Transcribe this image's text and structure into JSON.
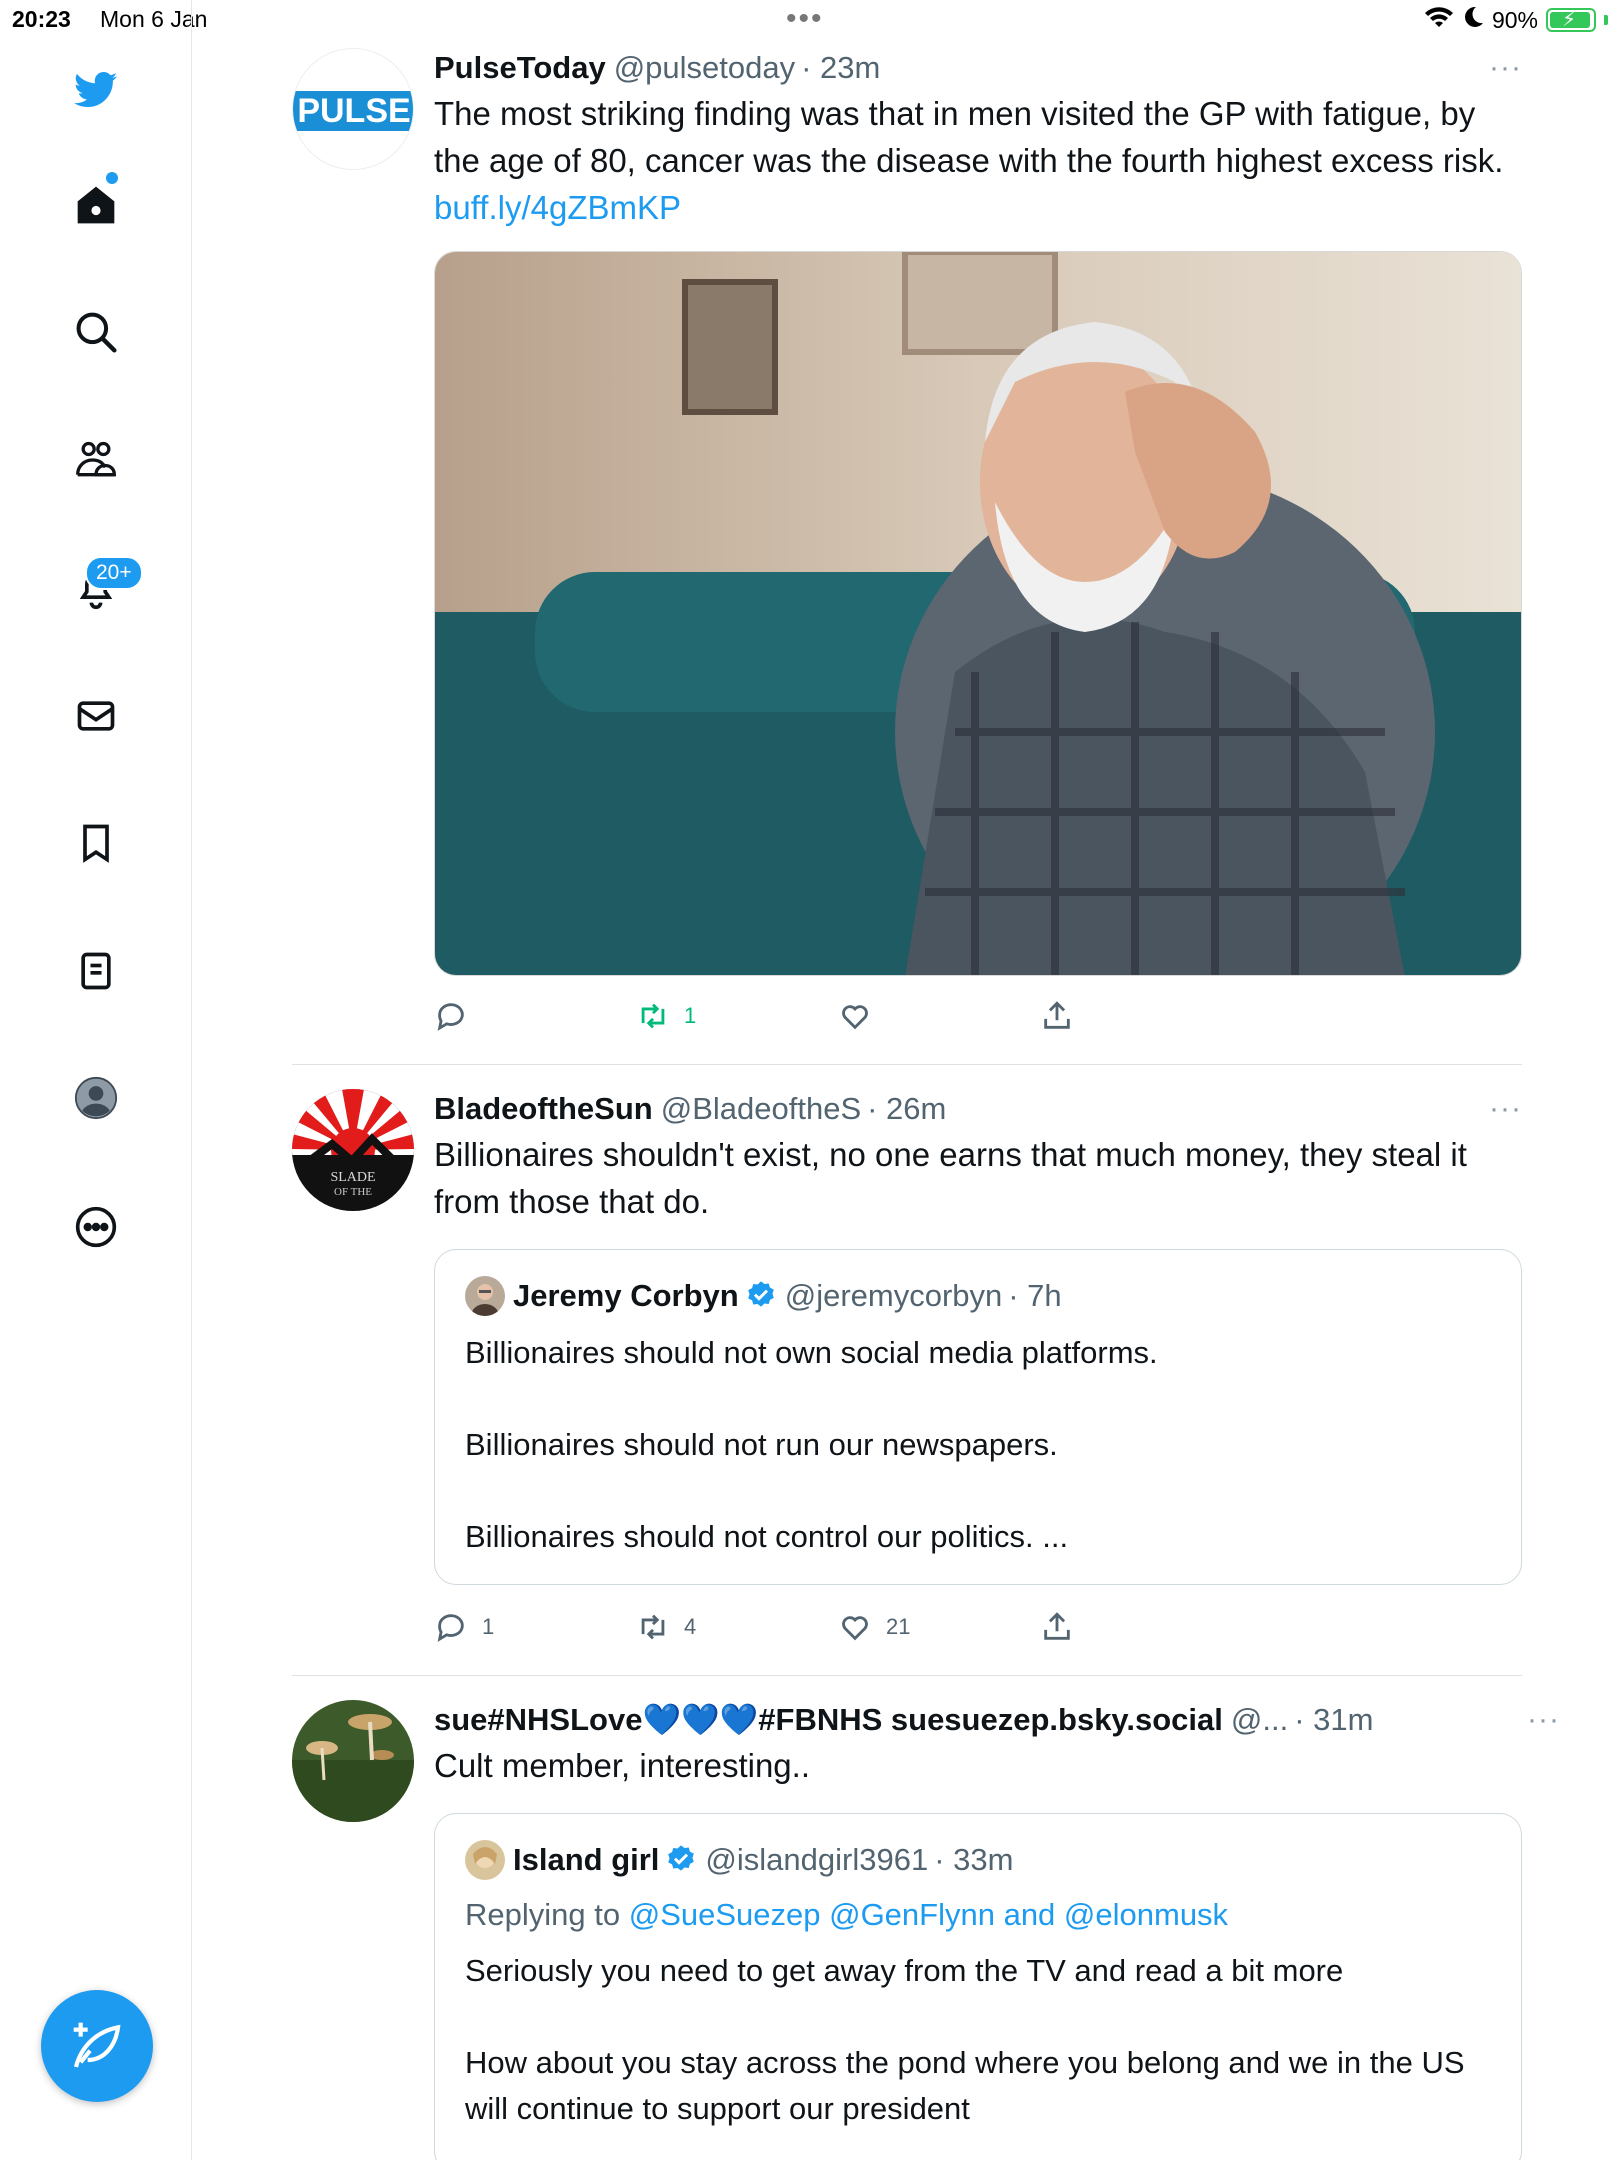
{
  "status_bar": {
    "time": "20:23",
    "date": "Mon 6 Jan",
    "battery": "90%"
  },
  "sidebar": {
    "notifications_badge": "20+",
    "items": [
      "twitter-logo",
      "home",
      "search",
      "communities",
      "notifications",
      "messages",
      "bookmarks",
      "lists",
      "profile",
      "more"
    ]
  },
  "tweets": [
    {
      "name": "PulseToday",
      "handle": "@pulsetoday",
      "time": "· 23m",
      "avatar_text": "PULSE",
      "text": "The most striking finding was that in men visited the GP with fatigue, by the age of 80, cancer was the disease with the fourth highest excess risk.",
      "link": "buff.ly/4gZBmKP",
      "replies": "",
      "retweets": "1",
      "likes": ""
    },
    {
      "name": "BladeoftheSun",
      "handle": "@BladeoftheS",
      "time": "· 26m",
      "avatar_text": "BLADE OF THE",
      "text": "Billionaires shouldn't exist, no one earns that much money, they steal it from those that do.",
      "quote": {
        "name": "Jeremy Corbyn",
        "handle": "@jeremycorbyn",
        "time": "· 7h",
        "lines": [
          "Billionaires should not own social media platforms.",
          "Billionaires should not run our newspapers.",
          "Billionaires should not control our politics. ..."
        ]
      },
      "replies": "1",
      "retweets": "4",
      "likes": "21"
    },
    {
      "name_pre": "sue#NHSLove",
      "hearts": "💙💙💙",
      "name_post": "#FBNHS suesuezep.bsky.social",
      "handle": "@...",
      "time": "· 31m",
      "text": "Cult member, interesting..",
      "quote": {
        "name": "Island girl",
        "handle": "@islandgirl3961",
        "time": "· 33m",
        "replying_label": "Replying to",
        "replying_to": "@SueSuezep @GenFlynn and @elonmusk",
        "lines": [
          "Seriously you need to get away from the TV and read a bit more",
          "How about you stay across the pond where you belong and we in the US will continue to support our president"
        ]
      }
    }
  ],
  "colors": {
    "accent": "#1d9bf0",
    "retweet": "#00ba7c",
    "muted": "#536471"
  }
}
